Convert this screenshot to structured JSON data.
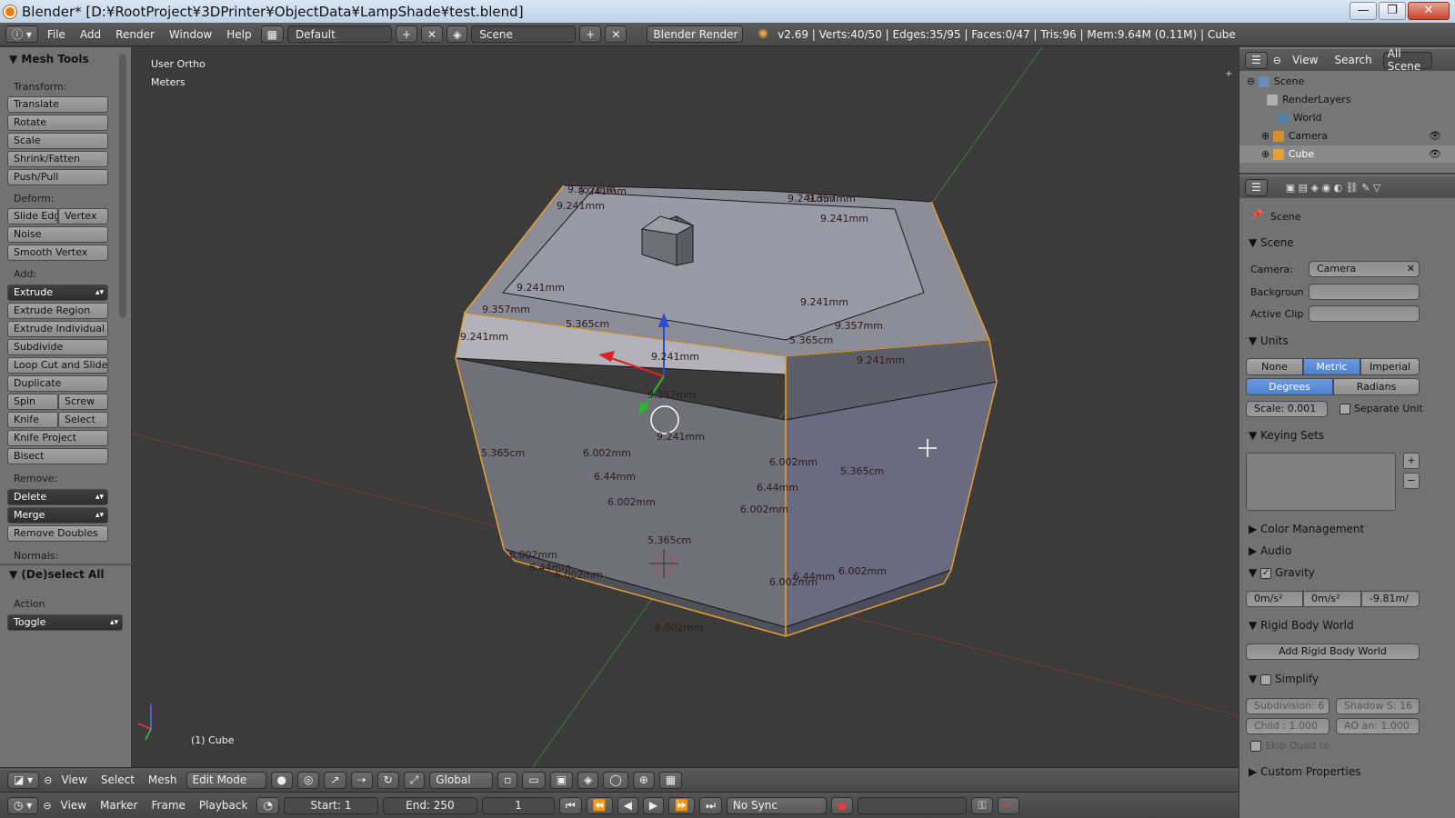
{
  "window": {
    "title": "Blender* [D:¥RootProject¥3DPrinter¥ObjectData¥LampShade¥test.blend]",
    "minimize": "—",
    "maximize": "❐",
    "close": "✕"
  },
  "topbar": {
    "menus": [
      "File",
      "Add",
      "Render",
      "Window",
      "Help"
    ],
    "layout": "Default",
    "scene": "Scene",
    "engine": "Blender Render",
    "stats": "v2.69 | Verts:40/50 | Edges:35/95 | Faces:0/47 | Tris:96 | Mem:9.64M (0.11M) | Cube"
  },
  "toolshelf": {
    "title": "Mesh Tools",
    "transform_label": "Transform:",
    "transform": [
      "Translate",
      "Rotate",
      "Scale",
      "Shrink/Fatten",
      "Push/Pull"
    ],
    "deform_label": "Deform:",
    "slide_edge": "Slide Edg",
    "vertex": "Vertex",
    "noise": "Noise",
    "smooth_vertex": "Smooth Vertex",
    "add_label": "Add:",
    "extrude": "Extrude",
    "add_items": [
      "Extrude Region",
      "Extrude Individual",
      "Subdivide",
      "Loop Cut and Slide"
    ],
    "duplicate": "Duplicate",
    "spin": "Spin",
    "screw": "Screw",
    "knife": "Knife",
    "select": "Select",
    "knife_project": "Knife Project",
    "bisect": "Bisect",
    "remove_label": "Remove:",
    "delete": "Delete",
    "merge": "Merge",
    "remove_doubles": "Remove Doubles",
    "normals_label": "Normals:",
    "deselect_title": "(De)select All",
    "action_label": "Action",
    "action_value": "Toggle"
  },
  "viewport": {
    "view_name": "User Ortho",
    "units": "Meters",
    "object_label": "(1) Cube",
    "dimensions": [
      {
        "t": "9.357mm"
      },
      {
        "t": "9.241mm"
      },
      {
        "t": "9.241mm"
      },
      {
        "t": "9.241mm"
      },
      {
        "t": "9.357mm"
      },
      {
        "t": "9.241mm"
      },
      {
        "t": "9.241mm"
      },
      {
        "t": "9.357mm"
      },
      {
        "t": "9.241mm"
      },
      {
        "t": "5.365cm"
      },
      {
        "t": "9.241mm"
      },
      {
        "t": "9.357mm"
      },
      {
        "t": "9.241mm"
      },
      {
        "t": "5.365cm"
      },
      {
        "t": "9.241mm"
      },
      {
        "t": "9.357mm"
      },
      {
        "t": "9.241mm"
      },
      {
        "t": "5.365cm"
      },
      {
        "t": "6.002mm"
      },
      {
        "t": "6.44mm"
      },
      {
        "t": "6.002mm"
      },
      {
        "t": "6.002mm"
      },
      {
        "t": "6.44mm"
      },
      {
        "t": "6.002mm"
      },
      {
        "t": "5.365cm"
      },
      {
        "t": "5.365cm"
      },
      {
        "t": "6.002mm"
      },
      {
        "t": "6.44mm"
      },
      {
        "t": "6.002mm"
      },
      {
        "t": "6.002mm"
      },
      {
        "t": "6.44mm"
      },
      {
        "t": "6.002mm"
      },
      {
        "t": "6.002mm"
      }
    ]
  },
  "outliner": {
    "view": "View",
    "search": "Search",
    "filter": "All Scene",
    "items": [
      "Scene",
      "RenderLayers",
      "World",
      "Camera",
      "Cube"
    ]
  },
  "properties": {
    "breadcrumb": "Scene",
    "scene_title": "Scene",
    "camera_label": "Camera:",
    "camera_value": "Camera",
    "background_label": "Backgroun",
    "active_clip_label": "Active Clip",
    "units_title": "Units",
    "unit_none": "None",
    "unit_metric": "Metric",
    "unit_imperial": "Imperial",
    "degrees": "Degrees",
    "radians": "Radians",
    "scale": "Scale: 0.001",
    "separate_units": "Separate Unit",
    "keying_sets": "Keying Sets",
    "color_management": "Color Management",
    "audio": "Audio",
    "gravity": "Gravity",
    "gravity_x": "0m/s²",
    "gravity_y": "0m/s²",
    "gravity_z": "-9.81m/",
    "rigid_body_world": "Rigid Body World",
    "add_rigid_body_world": "Add Rigid Body World",
    "simplify": "Simplify",
    "subdivision": "Subdivision: 6",
    "shadow": "Shadow S: 16",
    "child": "Child : 1.000",
    "ao": "AO an: 1.000",
    "skip_quad": "Skip Quad to",
    "custom_properties": "Custom Properties"
  },
  "viewport_header": {
    "menus": [
      "View",
      "Select",
      "Mesh"
    ],
    "mode": "Edit Mode",
    "orientation": "Global"
  },
  "timeline": {
    "menus": [
      "View",
      "Marker",
      "Frame",
      "Playback"
    ],
    "start": "Start: 1",
    "end": "End: 250",
    "current": "1",
    "sync": "No Sync"
  }
}
